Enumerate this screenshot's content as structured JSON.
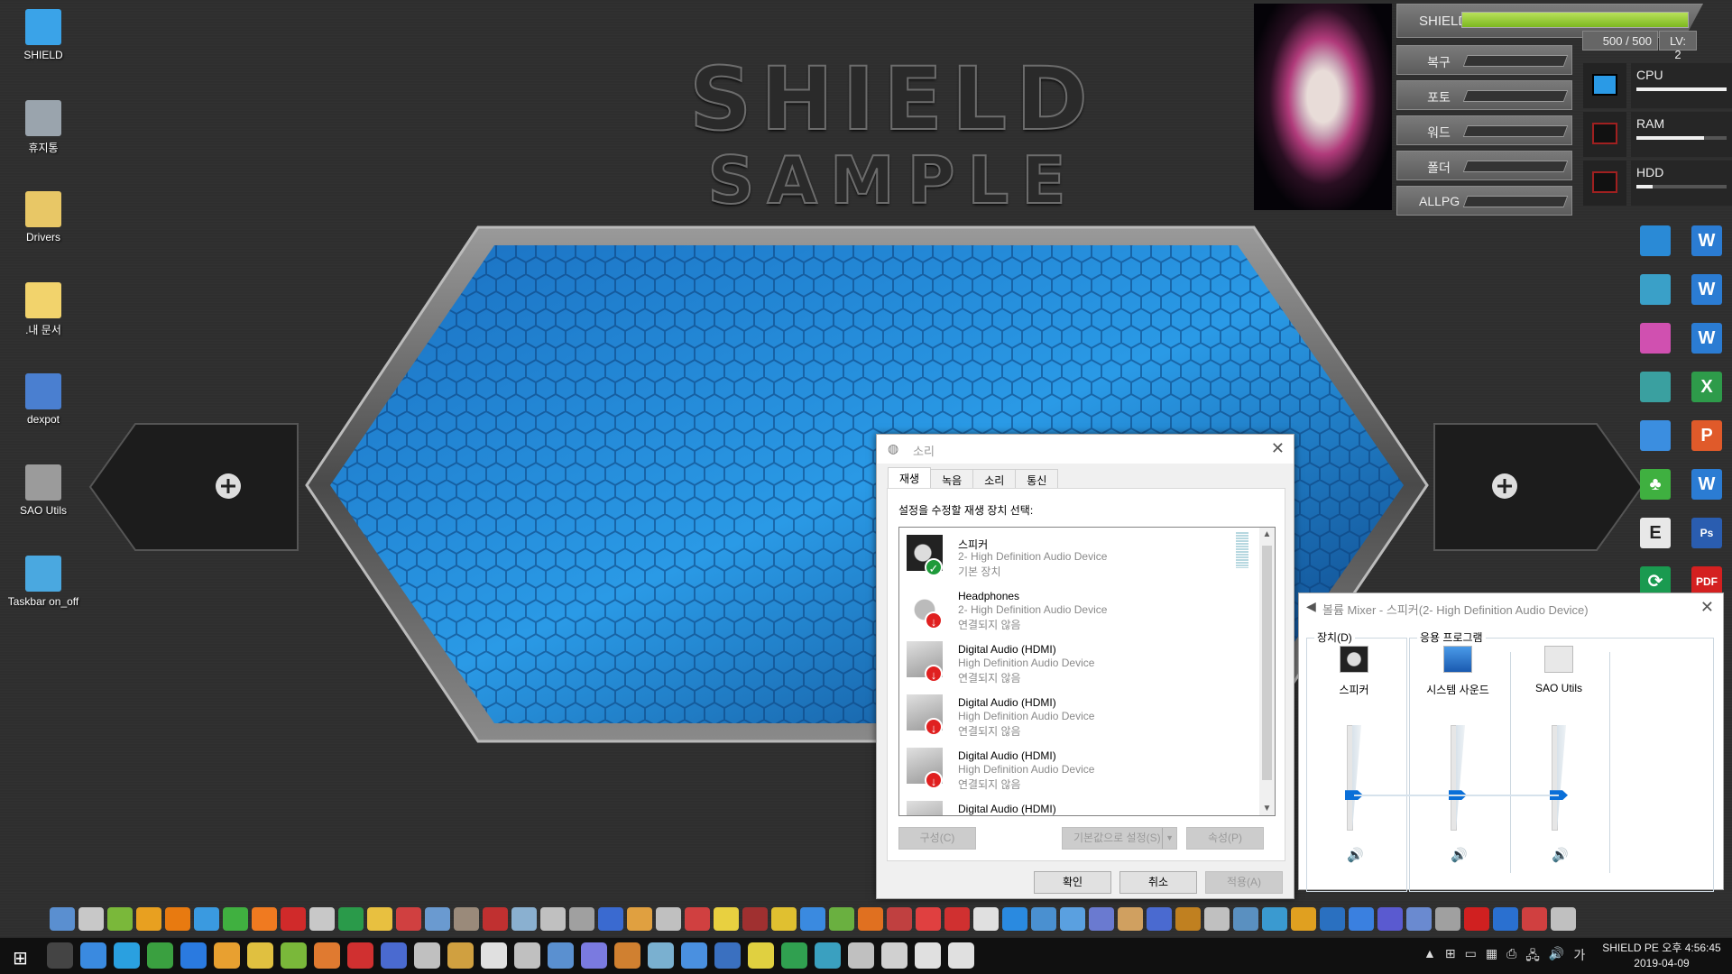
{
  "desktop": {
    "icons": [
      {
        "label": "SHIELD",
        "icon": "computer-icon",
        "color": "#3aa3e8"
      },
      {
        "label": "휴지통",
        "icon": "recycle-bin-icon",
        "color": "#9aa4ad"
      },
      {
        "label": "Drivers",
        "icon": "folder-icon",
        "color": "#e8c766"
      },
      {
        "label": ".내 문서",
        "icon": "documents-folder-icon",
        "color": "#f2d36c"
      },
      {
        "label": "dexpot",
        "icon": "dexpot-icon",
        "color": "#4a7fd0"
      },
      {
        "label": "SAO Utils",
        "icon": "sao-utils-icon",
        "color": "#9b9b9b"
      },
      {
        "label": "Taskbar on_off",
        "icon": "taskbar-icon",
        "color": "#4aa8e0"
      }
    ]
  },
  "wallpaper": {
    "title_line1": "SHIELD",
    "title_line2": "SAMPLE",
    "accent": "#1c7fd4"
  },
  "status_panel": {
    "shield_label": "SHIELD",
    "shield_value": "500 / 500",
    "shield_fraction": 1.0,
    "level": "LV: 2",
    "color": "#8cc63f",
    "rows": [
      "복구",
      "포토",
      "워드",
      "폴더",
      "ALLPG"
    ],
    "monitors": [
      {
        "label": "CPU",
        "percent": 100,
        "icon": "monitor-icon"
      },
      {
        "label": "RAM",
        "percent": 75,
        "icon": "server-icon"
      },
      {
        "label": "HDD",
        "percent": 18,
        "icon": "server-icon"
      }
    ]
  },
  "right_icons": [
    {
      "icon": "monitor-icon",
      "glyph": "",
      "color": "#2a8ad6"
    },
    {
      "icon": "word-icon",
      "glyph": "W",
      "color": "#2b7cd3"
    },
    {
      "icon": "monitor-icon",
      "glyph": "",
      "color": "#3aa0c8"
    },
    {
      "icon": "word-icon",
      "glyph": "W",
      "color": "#2b7cd3"
    },
    {
      "icon": "folder-pink-icon",
      "glyph": "",
      "color": "#d050b0"
    },
    {
      "icon": "word-icon",
      "glyph": "W",
      "color": "#2b7cd3"
    },
    {
      "icon": "monitor-icon",
      "glyph": "",
      "color": "#3aa0a0"
    },
    {
      "icon": "excel-icon",
      "glyph": "X",
      "color": "#2e9b4a"
    },
    {
      "icon": "computer-icon",
      "glyph": "",
      "color": "#3b8ee0"
    },
    {
      "icon": "powerpoint-icon",
      "glyph": "P",
      "color": "#e05a2a"
    },
    {
      "icon": "clover-icon",
      "glyph": "♣",
      "color": "#3fb040"
    },
    {
      "icon": "word-icon",
      "glyph": "W",
      "color": "#2b7cd3"
    },
    {
      "icon": "editor-icon",
      "glyph": "E",
      "color": "#e8e8e8"
    },
    {
      "icon": "photoshop-icon",
      "glyph": "Ps",
      "color": "#2a5db0"
    },
    {
      "icon": "refresh-icon",
      "glyph": "⟳",
      "color": "#1a9a50"
    },
    {
      "icon": "pdf-icon",
      "glyph": "PDF",
      "color": "#d42020"
    }
  ],
  "sound_dialog": {
    "title": "소리",
    "close": "✕",
    "tabs": [
      "재생",
      "녹음",
      "소리",
      "통신"
    ],
    "active_tab": 0,
    "prompt": "설정을 수정할 재생 장치 선택:",
    "devices": [
      {
        "name": "스피커",
        "desc": "2- High Definition Audio Device",
        "status": "기본 장치",
        "icon": "speaker-icon",
        "badge": "default"
      },
      {
        "name": "Headphones",
        "desc": "2- High Definition Audio Device",
        "status": "연결되지 않음",
        "icon": "headphones-icon",
        "badge": "disconnected"
      },
      {
        "name": "Digital Audio (HDMI)",
        "desc": "High Definition Audio Device",
        "status": "연결되지 않음",
        "icon": "hdmi-monitor-icon",
        "badge": "disconnected"
      },
      {
        "name": "Digital Audio (HDMI)",
        "desc": "High Definition Audio Device",
        "status": "연결되지 않음",
        "icon": "hdmi-monitor-icon",
        "badge": "disconnected"
      },
      {
        "name": "Digital Audio (HDMI)",
        "desc": "High Definition Audio Device",
        "status": "연결되지 않음",
        "icon": "hdmi-monitor-icon",
        "badge": "disconnected"
      },
      {
        "name": "Digital Audio (HDMI)",
        "desc": "",
        "status": "",
        "icon": "hdmi-monitor-icon",
        "badge": ""
      }
    ],
    "buttons": {
      "configure": "구성(C)",
      "set_default": "기본값으로 설정(S)",
      "properties": "속성(P)",
      "ok": "확인",
      "cancel": "취소",
      "apply": "적용(A)"
    }
  },
  "mixer": {
    "title": "볼륨 Mixer - 스피커(2- High Definition Audio Device)",
    "close": "✕",
    "device_group": "장치(D)",
    "apps_group": "응용 프로그램",
    "channels": [
      {
        "label": "스피커",
        "icon": "speaker-icon",
        "volume": 34
      },
      {
        "label": "시스템 사운드",
        "icon": "system-sounds-icon",
        "volume": 34
      },
      {
        "label": "SAO Utils",
        "icon": "sao-utils-icon",
        "volume": 34
      }
    ]
  },
  "quick_launch": [
    "#5a8fd0",
    "#c8c8c8",
    "#7ab83a",
    "#e8a020",
    "#e87a10",
    "#3a9ae0",
    "#40b040",
    "#f07a20",
    "#d02a2a",
    "#c8c8c8",
    "#2a9a4a",
    "#e8c040",
    "#d04040",
    "#6a9ad0",
    "#9a8a7a",
    "#c03030",
    "#8ab0d0",
    "#c0c0c0",
    "#a0a0a0",
    "#3a6ad0",
    "#e0a040",
    "#c0c0c0",
    "#d04040",
    "#e8d040",
    "#a03030",
    "#e0c030",
    "#3a8ae0",
    "#6ab040",
    "#e07020",
    "#c04040",
    "#e04040",
    "#d03030",
    "#e0e0e0",
    "#2a8ae0",
    "#4a90d0",
    "#5aa0e0",
    "#6a7ad0",
    "#d0a060",
    "#4a6ad0",
    "#c08020",
    "#c0c0c0",
    "#5a90c0",
    "#3a9ad0",
    "#e0a020",
    "#2a70c0",
    "#3a80e0",
    "#5a5ad0",
    "#6a8ad0",
    "#a0a0a0",
    "#d02020",
    "#2a70d0",
    "#d04040",
    "#c0c0c0"
  ],
  "taskbar": {
    "start_icon": "windows-start-icon",
    "apps": [
      "#444",
      "#3a8ae0",
      "#2aa0e0",
      "#3aa040",
      "#2a7ae0",
      "#e8a030",
      "#e0c040",
      "#7ab83a",
      "#e07a30",
      "#d03030",
      "#4a6ad0",
      "#c0c0c0",
      "#d0a040",
      "#e0e0e0",
      "#c0c0c0",
      "#5a90d0",
      "#7a7ae0",
      "#d08030",
      "#7ab0d0",
      "#4a90e0",
      "#3a70c0",
      "#e0d040",
      "#30a050",
      "#3aa0c0",
      "#c0c0c0",
      "#d0d0d0",
      "#e0e0e0",
      "#e0e0e0"
    ],
    "tray": [
      "▲",
      "⊞",
      "▭",
      "▦",
      "⎙",
      "🖧",
      "🔊",
      "가"
    ],
    "clock_line1": "SHIELD PE 오후 4:56:45",
    "clock_line2": "2019-04-09"
  }
}
